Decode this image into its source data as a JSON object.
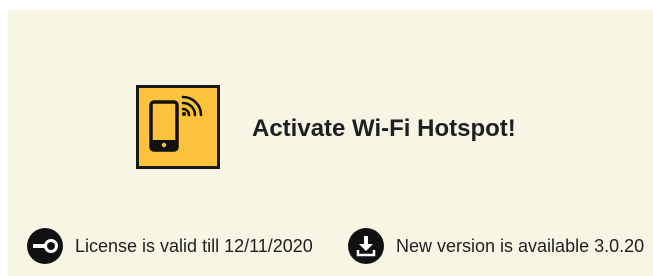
{
  "hero": {
    "icon": "phone-wifi-icon",
    "tile_color": "#fdc33a",
    "headline": "Activate Wi-Fi Hotspot!"
  },
  "status": {
    "license": {
      "icon": "key-icon",
      "text": "License is valid till 12/11/2020"
    },
    "update": {
      "icon": "download-icon",
      "text": "New version is available 3.0.20"
    }
  },
  "colors": {
    "background": "#f7f6e5",
    "text": "#1f1f1f",
    "icon": "#111111"
  }
}
